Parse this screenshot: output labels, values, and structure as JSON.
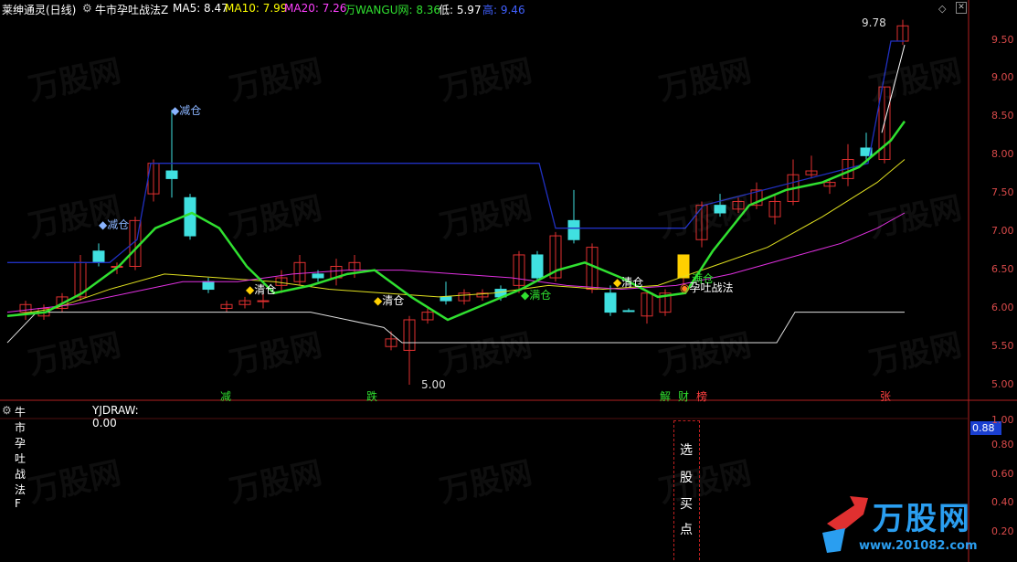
{
  "header": {
    "stock_name": "莱绅通灵(日线)",
    "indicator_title": "牛市孕吐战法Z",
    "ma5": "MA5: 8.47",
    "ma10": "MA10: 7.99",
    "ma20": "MA20: 7.26",
    "wangu": "万WANGU网: 8.36",
    "low": "低: 5.97",
    "high": "高: 9.46"
  },
  "colors": {
    "ma5": "#ffffff",
    "ma10": "#ffff00",
    "ma20": "#ff40ff",
    "wangu": "#30e030",
    "low": "#ffffff",
    "high": "#4040ff",
    "up": "#e03030",
    "down": "#40e0e0"
  },
  "price_axis": {
    "ticks": [
      "9.50",
      "9.00",
      "8.50",
      "8.00",
      "7.50",
      "7.00",
      "6.50",
      "6.00",
      "5.50",
      "5.00"
    ]
  },
  "annotations": {
    "max_price": "9.78",
    "min_price": "5.00",
    "reduce1": "减仓",
    "reduce2": "减仓",
    "clear1": "清仓",
    "clear2": "清仓",
    "clear3": "清仓",
    "clear4": "清仓",
    "full": "满仓",
    "tactic": "孕吐战法",
    "full2": "满仓"
  },
  "day_labels": {
    "jian": "减",
    "die": "跌",
    "jie": "解",
    "cai": "财",
    "bang": "榜",
    "zhang": "张"
  },
  "sub_chart": {
    "title": "牛市孕吐战法F",
    "yjdraw": "YJDRAW: 0.00",
    "badge": "0.88",
    "ticks": [
      "1.00",
      "0.80",
      "0.60",
      "0.40",
      "0.20"
    ],
    "signal_chars": [
      "选",
      "股",
      "买",
      "点"
    ]
  },
  "logo": {
    "text": "万股网",
    "url": "www.201082.com"
  },
  "watermark": "万股网"
}
